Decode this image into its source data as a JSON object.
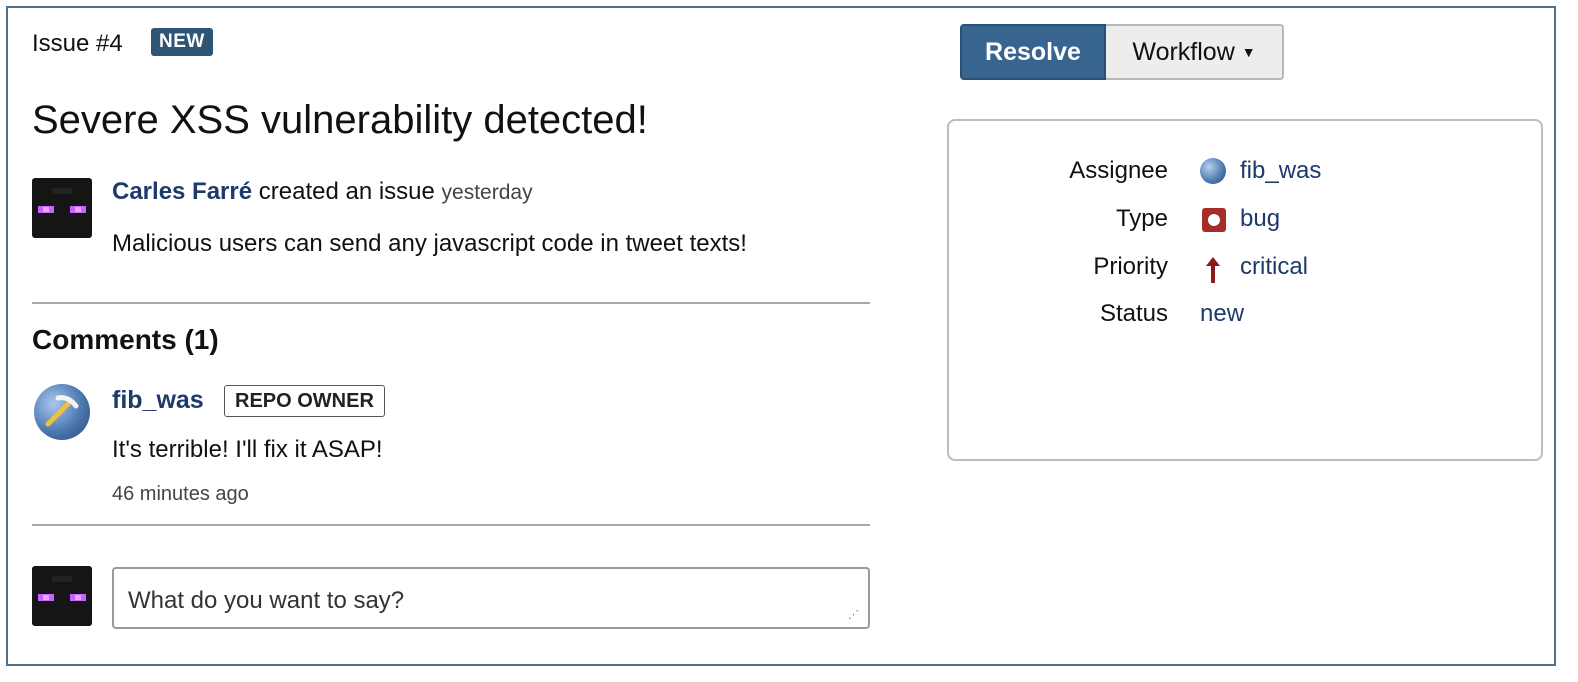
{
  "issue": {
    "label": "Issue #4",
    "status_badge": "NEW",
    "title": "Severe XSS vulnerability detected!",
    "creator": "Carles Farré",
    "created_action": " created an issue ",
    "created_time": "yesterday",
    "description": "Malicious users can send any javascript code in tweet texts!"
  },
  "comments": {
    "heading": "Comments (1)",
    "items": [
      {
        "author": "fib_was",
        "role": "REPO OWNER",
        "text": "It's terrible! I'll fix it ASAP!",
        "time": "46 minutes ago"
      }
    ],
    "input_placeholder": "What do you want to say?"
  },
  "actions": {
    "resolve_label": "Resolve",
    "workflow_label": "Workflow"
  },
  "details": {
    "assignee_label": "Assignee",
    "assignee_value": "fib_was",
    "type_label": "Type",
    "type_value": "bug",
    "priority_label": "Priority",
    "priority_value": "critical",
    "status_label": "Status",
    "status_value": "new"
  },
  "icons": {
    "assignee": "user-avatar-icon",
    "type": "bug-icon",
    "priority": "arrow-up-icon",
    "workflow_dropdown": "caret-down-icon"
  },
  "colors": {
    "accent": "#376590",
    "badge": "#2f5576",
    "link": "#1d3a6b",
    "priority_critical": "#8b1a1a",
    "bug": "#a62b2b",
    "frame_border": "#4f6f8f"
  }
}
